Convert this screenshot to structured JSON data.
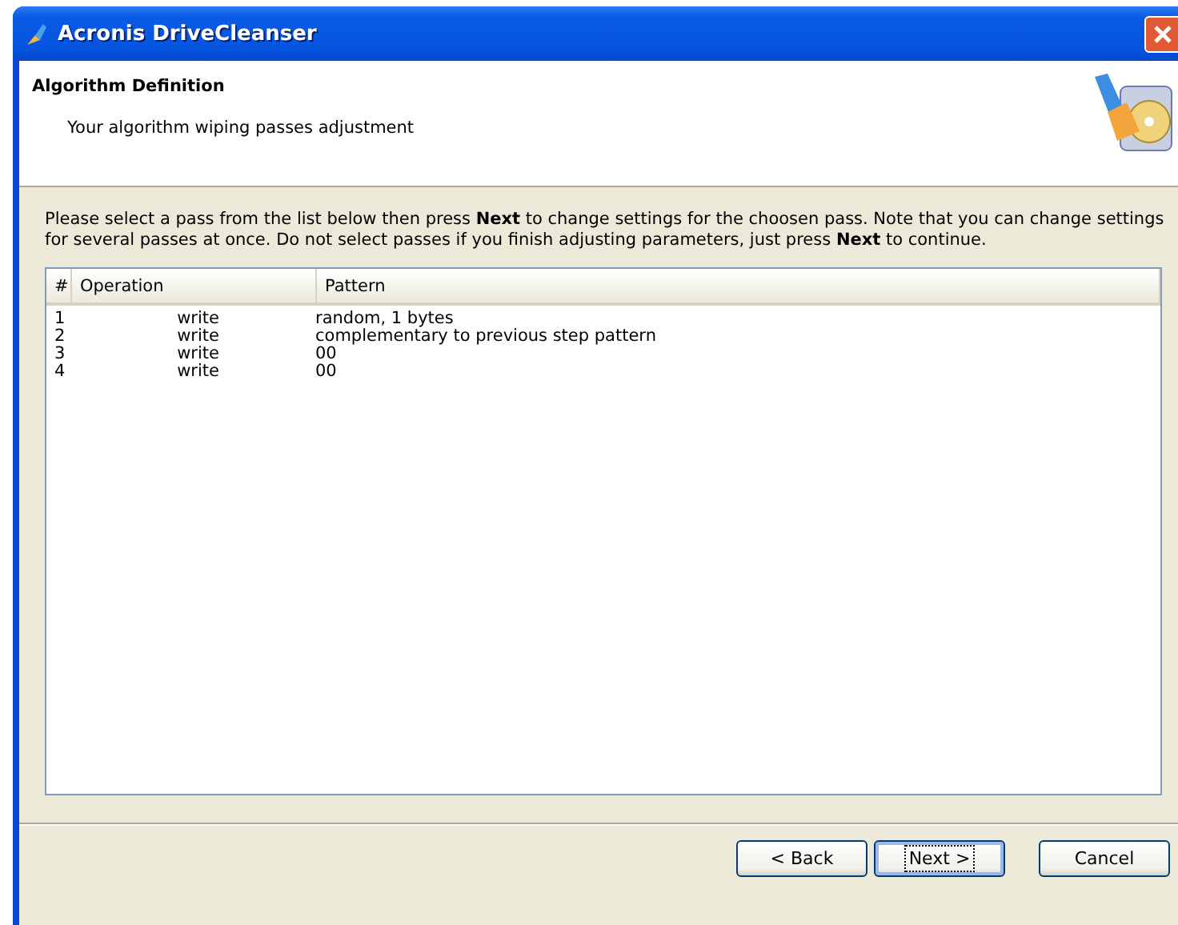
{
  "window": {
    "title": "Acronis DriveCleanser"
  },
  "header": {
    "title": "Algorithm Definition",
    "subtitle": "Your algorithm wiping passes adjustment"
  },
  "instructions": "Please select a pass from the list below then press **Next** to change settings for the choosen pass. Note that you can change settings for several passes at once. Do not select passes if you finish adjusting parameters, just press **Next** to continue.",
  "table": {
    "columns": [
      "#",
      "Operation",
      "Pattern"
    ],
    "rows": [
      {
        "cells": [
          "1",
          "write",
          "random, 1 bytes"
        ],
        "selected": false
      },
      {
        "cells": [
          "2",
          "write",
          "complementary to previous step pattern"
        ],
        "selected": false
      },
      {
        "cells": [
          "3",
          "write",
          "00"
        ],
        "selected": false
      },
      {
        "cells": [
          "4",
          "write",
          "00"
        ],
        "selected": false
      }
    ]
  },
  "buttons": [
    {
      "label": "< Back",
      "default": false
    },
    {
      "label": "Next >",
      "default": true
    },
    {
      "label": "Cancel",
      "default": false
    }
  ]
}
